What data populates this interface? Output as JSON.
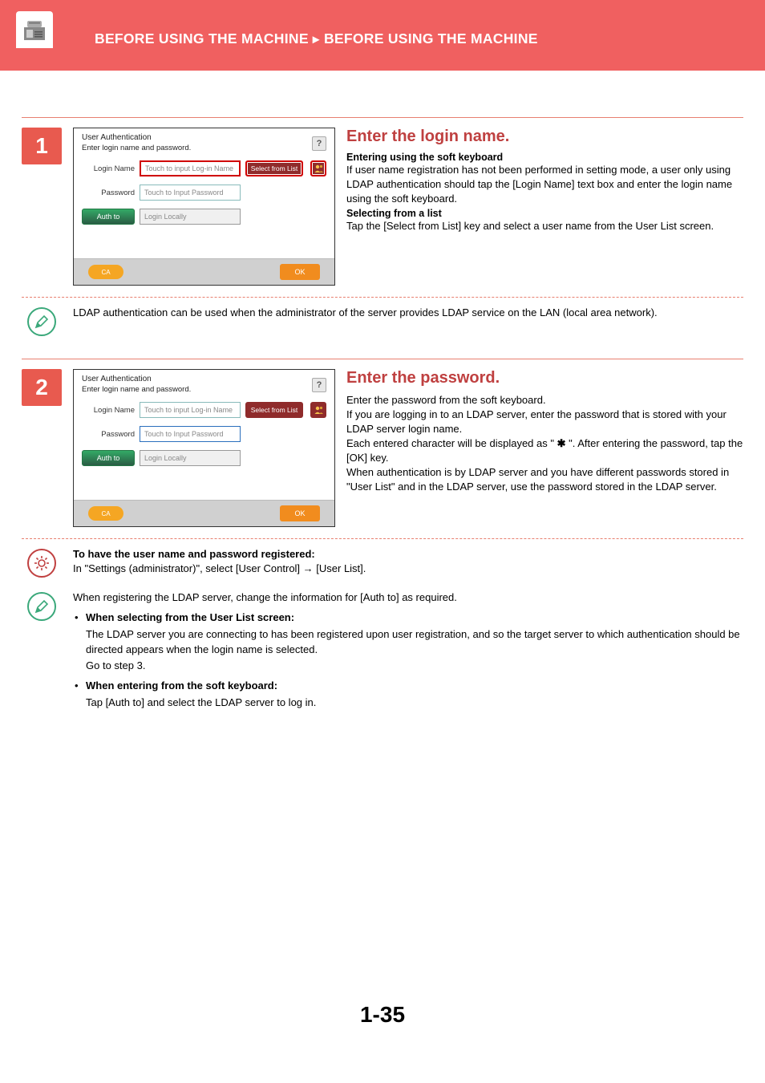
{
  "header": {
    "breadcrumb_a": "BEFORE USING THE MACHINE",
    "breadcrumb_b": "BEFORE USING THE MACHINE"
  },
  "panel": {
    "title": "User Authentication",
    "subtitle": "Enter login name and password.",
    "help": "?",
    "loginName": "Login Name",
    "loginPh": "Touch to input Log-in Name",
    "password": "Password",
    "passwordPh": "Touch to Input Password",
    "authto": "Auth to",
    "locally": "Login Locally",
    "selectList": "Select from List",
    "ca": "CA",
    "ok": "OK"
  },
  "step1": {
    "num": "1",
    "heading": "Enter the login name.",
    "sub1": "Entering using the soft keyboard",
    "p1": "If user name registration has not been performed in setting mode, a user only using LDAP authentication should tap the [Login Name] text box and enter the login name using the soft keyboard.",
    "sub2": "Selecting from a list",
    "p2": "Tap the [Select from List] key and select a user name from the User List screen."
  },
  "note1": "LDAP authentication can be used when the administrator of the server provides LDAP service on the LAN (local area network).",
  "step2": {
    "num": "2",
    "heading": "Enter the password.",
    "p1": "Enter the password from the soft keyboard.",
    "p2": "If you are logging in to an LDAP server, enter the password that is stored with your LDAP server login name.",
    "p3a": "Each entered character will be displayed as \" ",
    "ast": "✱",
    "p3b": " \". After entering the password, tap the [OK] key.",
    "p4": "When authentication is by LDAP server and you have different passwords stored in \"User List\" and in the LDAP server, use the password stored in the LDAP server."
  },
  "gearNote": {
    "h": "To have the user name and password registered:",
    "p": "In \"Settings (administrator)\", select [User Control] → [User List]."
  },
  "pencilNote2": {
    "p": "When registering the LDAP server, change the information for [Auth to] as required.",
    "b1h": "When selecting from the User List screen:",
    "b1p": "The LDAP server you are connecting to has been registered upon user registration, and so the target server to which authentication should be directed appears when the login name is selected.\nGo to step 3.",
    "b2h": "When entering from the soft keyboard:",
    "b2p": "Tap [Auth to] and select the LDAP server to log in."
  },
  "pageNum": "1-35"
}
